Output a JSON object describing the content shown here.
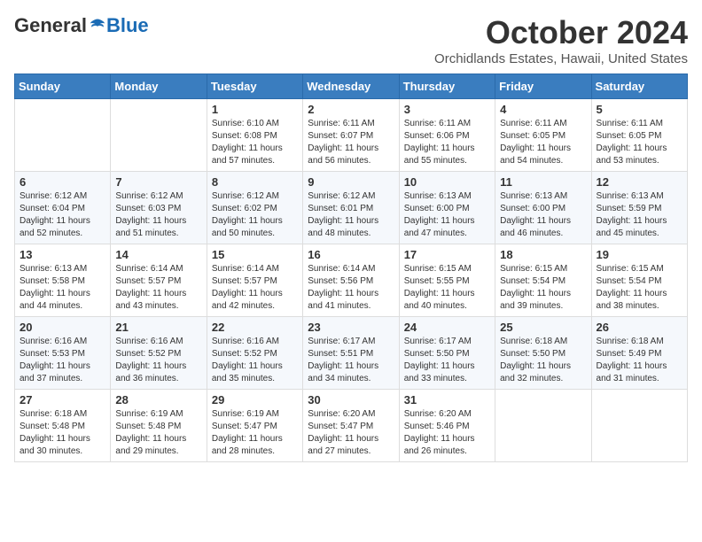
{
  "header": {
    "logo_general": "General",
    "logo_blue": "Blue",
    "month_title": "October 2024",
    "subtitle": "Orchidlands Estates, Hawaii, United States"
  },
  "weekdays": [
    "Sunday",
    "Monday",
    "Tuesday",
    "Wednesday",
    "Thursday",
    "Friday",
    "Saturday"
  ],
  "weeks": [
    [
      {
        "day": "",
        "info": ""
      },
      {
        "day": "",
        "info": ""
      },
      {
        "day": "1",
        "info": "Sunrise: 6:10 AM\nSunset: 6:08 PM\nDaylight: 11 hours and 57 minutes."
      },
      {
        "day": "2",
        "info": "Sunrise: 6:11 AM\nSunset: 6:07 PM\nDaylight: 11 hours and 56 minutes."
      },
      {
        "day": "3",
        "info": "Sunrise: 6:11 AM\nSunset: 6:06 PM\nDaylight: 11 hours and 55 minutes."
      },
      {
        "day": "4",
        "info": "Sunrise: 6:11 AM\nSunset: 6:05 PM\nDaylight: 11 hours and 54 minutes."
      },
      {
        "day": "5",
        "info": "Sunrise: 6:11 AM\nSunset: 6:05 PM\nDaylight: 11 hours and 53 minutes."
      }
    ],
    [
      {
        "day": "6",
        "info": "Sunrise: 6:12 AM\nSunset: 6:04 PM\nDaylight: 11 hours and 52 minutes."
      },
      {
        "day": "7",
        "info": "Sunrise: 6:12 AM\nSunset: 6:03 PM\nDaylight: 11 hours and 51 minutes."
      },
      {
        "day": "8",
        "info": "Sunrise: 6:12 AM\nSunset: 6:02 PM\nDaylight: 11 hours and 50 minutes."
      },
      {
        "day": "9",
        "info": "Sunrise: 6:12 AM\nSunset: 6:01 PM\nDaylight: 11 hours and 48 minutes."
      },
      {
        "day": "10",
        "info": "Sunrise: 6:13 AM\nSunset: 6:00 PM\nDaylight: 11 hours and 47 minutes."
      },
      {
        "day": "11",
        "info": "Sunrise: 6:13 AM\nSunset: 6:00 PM\nDaylight: 11 hours and 46 minutes."
      },
      {
        "day": "12",
        "info": "Sunrise: 6:13 AM\nSunset: 5:59 PM\nDaylight: 11 hours and 45 minutes."
      }
    ],
    [
      {
        "day": "13",
        "info": "Sunrise: 6:13 AM\nSunset: 5:58 PM\nDaylight: 11 hours and 44 minutes."
      },
      {
        "day": "14",
        "info": "Sunrise: 6:14 AM\nSunset: 5:57 PM\nDaylight: 11 hours and 43 minutes."
      },
      {
        "day": "15",
        "info": "Sunrise: 6:14 AM\nSunset: 5:57 PM\nDaylight: 11 hours and 42 minutes."
      },
      {
        "day": "16",
        "info": "Sunrise: 6:14 AM\nSunset: 5:56 PM\nDaylight: 11 hours and 41 minutes."
      },
      {
        "day": "17",
        "info": "Sunrise: 6:15 AM\nSunset: 5:55 PM\nDaylight: 11 hours and 40 minutes."
      },
      {
        "day": "18",
        "info": "Sunrise: 6:15 AM\nSunset: 5:54 PM\nDaylight: 11 hours and 39 minutes."
      },
      {
        "day": "19",
        "info": "Sunrise: 6:15 AM\nSunset: 5:54 PM\nDaylight: 11 hours and 38 minutes."
      }
    ],
    [
      {
        "day": "20",
        "info": "Sunrise: 6:16 AM\nSunset: 5:53 PM\nDaylight: 11 hours and 37 minutes."
      },
      {
        "day": "21",
        "info": "Sunrise: 6:16 AM\nSunset: 5:52 PM\nDaylight: 11 hours and 36 minutes."
      },
      {
        "day": "22",
        "info": "Sunrise: 6:16 AM\nSunset: 5:52 PM\nDaylight: 11 hours and 35 minutes."
      },
      {
        "day": "23",
        "info": "Sunrise: 6:17 AM\nSunset: 5:51 PM\nDaylight: 11 hours and 34 minutes."
      },
      {
        "day": "24",
        "info": "Sunrise: 6:17 AM\nSunset: 5:50 PM\nDaylight: 11 hours and 33 minutes."
      },
      {
        "day": "25",
        "info": "Sunrise: 6:18 AM\nSunset: 5:50 PM\nDaylight: 11 hours and 32 minutes."
      },
      {
        "day": "26",
        "info": "Sunrise: 6:18 AM\nSunset: 5:49 PM\nDaylight: 11 hours and 31 minutes."
      }
    ],
    [
      {
        "day": "27",
        "info": "Sunrise: 6:18 AM\nSunset: 5:48 PM\nDaylight: 11 hours and 30 minutes."
      },
      {
        "day": "28",
        "info": "Sunrise: 6:19 AM\nSunset: 5:48 PM\nDaylight: 11 hours and 29 minutes."
      },
      {
        "day": "29",
        "info": "Sunrise: 6:19 AM\nSunset: 5:47 PM\nDaylight: 11 hours and 28 minutes."
      },
      {
        "day": "30",
        "info": "Sunrise: 6:20 AM\nSunset: 5:47 PM\nDaylight: 11 hours and 27 minutes."
      },
      {
        "day": "31",
        "info": "Sunrise: 6:20 AM\nSunset: 5:46 PM\nDaylight: 11 hours and 26 minutes."
      },
      {
        "day": "",
        "info": ""
      },
      {
        "day": "",
        "info": ""
      }
    ]
  ]
}
